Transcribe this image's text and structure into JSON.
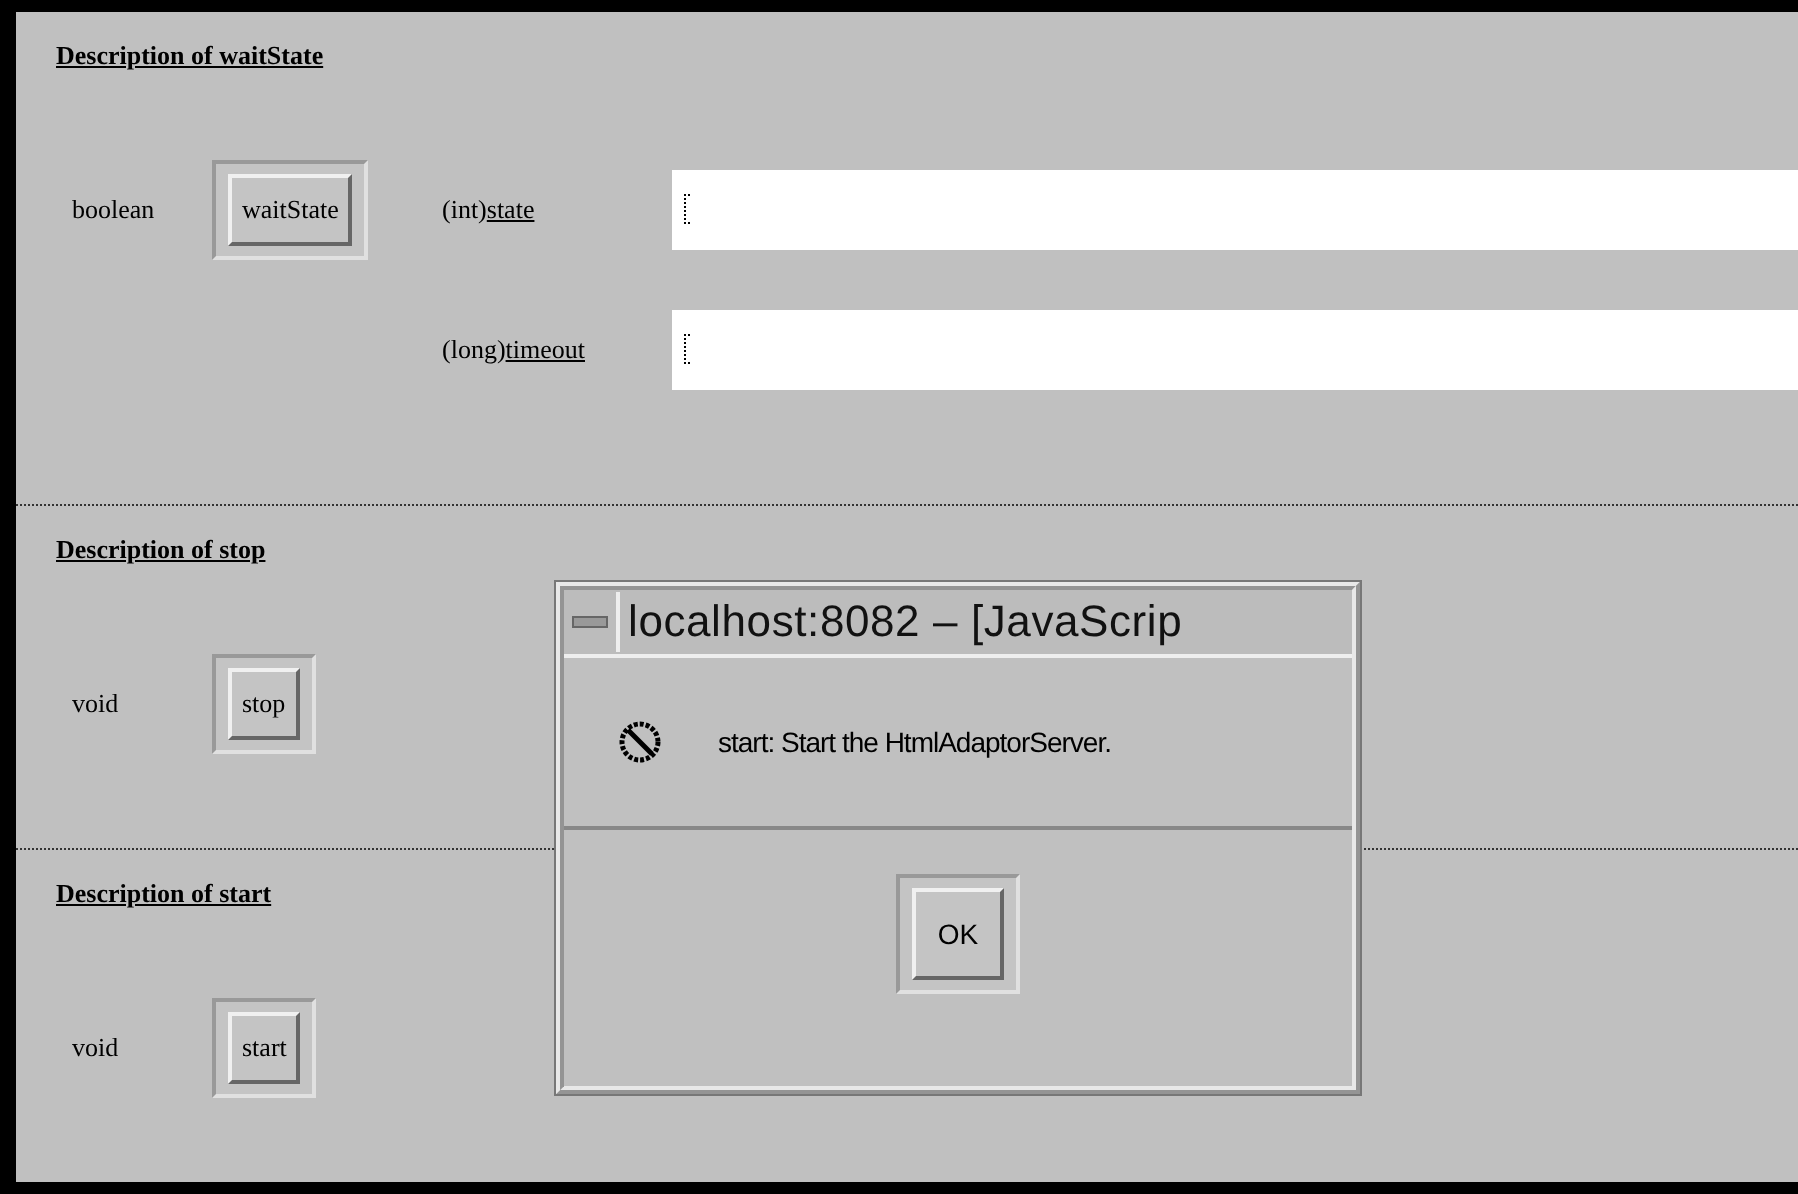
{
  "sections": [
    {
      "title": "Description of waitState",
      "method": {
        "return_type": "boolean",
        "name": "waitState"
      },
      "params": [
        {
          "type": "(int)",
          "name": "state"
        },
        {
          "type": "(long)",
          "name": "timeout"
        }
      ]
    },
    {
      "title": "Description of stop",
      "method": {
        "return_type": "void",
        "name": "stop"
      }
    },
    {
      "title": "Description of start",
      "method": {
        "return_type": "void",
        "name": "start"
      }
    }
  ],
  "dialog": {
    "title": "localhost:8082 – [JavaScrip",
    "message": "start: Start the HtmlAdaptorServer.",
    "button": "OK"
  }
}
